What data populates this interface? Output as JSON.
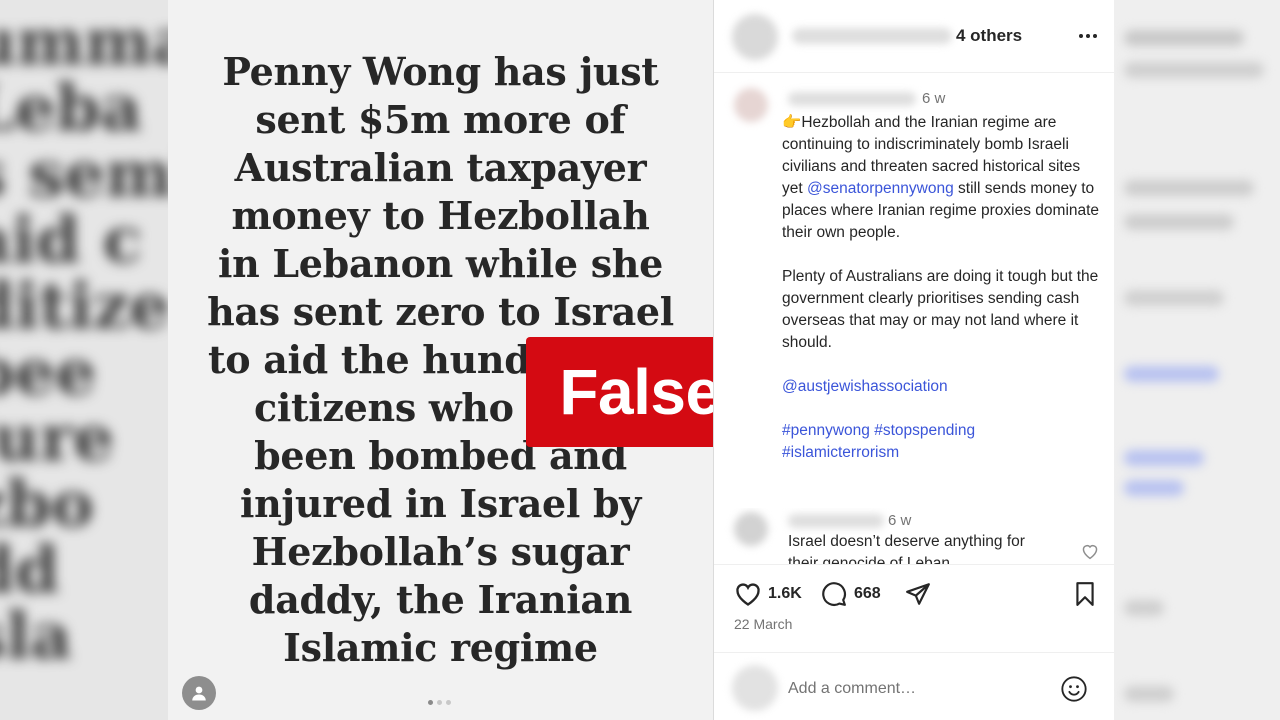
{
  "story": {
    "lines": [
      "Penny Wong has just",
      "sent $5m more of",
      "Australian taxpayer",
      "money to Hezbollah",
      "in Lebanon while she",
      "has sent zero to Israel",
      "to aid the hund",
      "citizens who",
      "been bombed and",
      "injured in Israel by",
      "Hezbollah’s sugar",
      "daddy, the Iranian",
      "Islamic regime"
    ]
  },
  "badge": {
    "label": "False",
    "color": "#d40a12"
  },
  "post": {
    "header": {
      "others_label": "4 others"
    },
    "caption": {
      "time": "6 w",
      "emoji": "👉",
      "paragraph1_text": "Hezbollah and the Iranian regime are continuing to indiscriminately bomb Israeli civilians and threaten sacred historical sites yet",
      "mention1": "@senatorpennywong",
      "paragraph1_tail": "still sends money to places where Iranian regime proxies dominate their own people.",
      "paragraph2": "Plenty of Australians are doing it tough but the government clearly prioritises sending cash overseas that may or may not land where it should.",
      "mention2": "@austjewishassociation",
      "hashtag1": "#pennywong",
      "hashtag2": "#stopspending",
      "hashtag3": "#islamicterrorism"
    },
    "comment": {
      "time": "6 w",
      "text": "Israel doesn’t deserve anything for",
      "text_cut": "their genocide of Leban"
    },
    "actions": {
      "likes": "1.6K",
      "comments": "668",
      "date": "22 March"
    },
    "add_comment_placeholder": "Add a comment…"
  },
  "colors": {
    "link": "#3b55d9",
    "badge": "#d40a12"
  }
}
